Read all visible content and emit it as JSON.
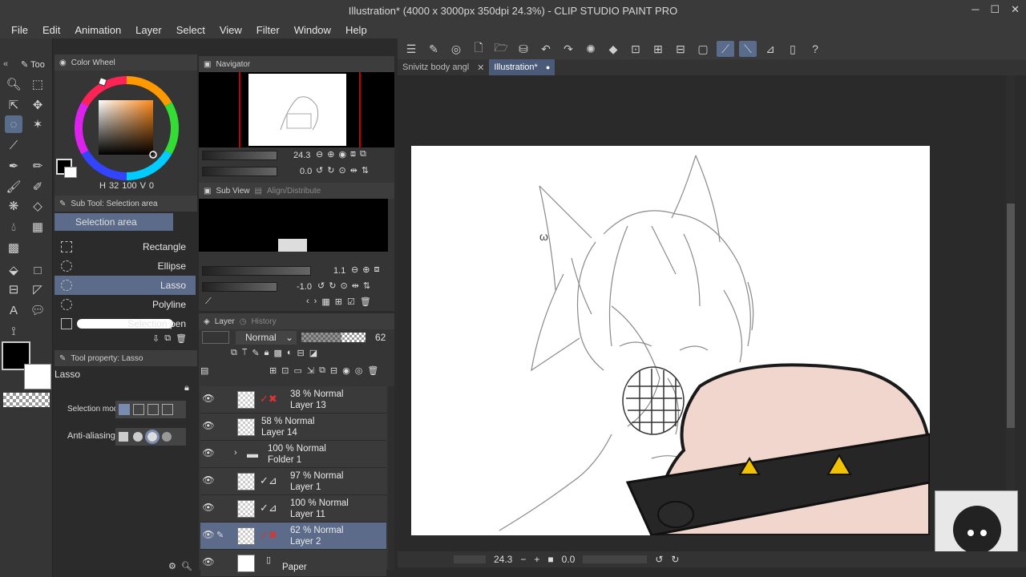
{
  "window": {
    "title": "Illustration* (4000 x 3000px 350dpi 24.3%) - CLIP STUDIO PAINT PRO",
    "controls": [
      "─",
      "☐",
      "✕"
    ]
  },
  "menu": [
    "File",
    "Edit",
    "Animation",
    "Layer",
    "Select",
    "View",
    "Filter",
    "Window",
    "Help"
  ],
  "doc_tabs": [
    {
      "label": "Snivitz body angl",
      "active": false
    },
    {
      "label": "Illustration*",
      "active": true
    }
  ],
  "tool_panel": {
    "tab_label": "Too"
  },
  "color_wheel": {
    "title": "Color Wheel",
    "value_a": "32",
    "value_b": "100",
    "value_c": "0",
    "main_color": "#000000",
    "sub_color": "#ffffff"
  },
  "navigator": {
    "title": "Navigator",
    "zoom": "24.3",
    "rotation": "0.0"
  },
  "sub_view": {
    "title": "Sub View",
    "tab2": "Align/Distribute",
    "zoom": "1.1",
    "rotation": "-1.0"
  },
  "sub_tool": {
    "title": "Sub Tool: Selection area",
    "group": "Selection area",
    "items": [
      {
        "label": "Rectangle",
        "selected": false
      },
      {
        "label": "Ellipse",
        "selected": false
      },
      {
        "label": "Lasso",
        "selected": true
      },
      {
        "label": "Polyline",
        "selected": false
      },
      {
        "label": "Selection pen",
        "selected": false
      }
    ]
  },
  "tool_property": {
    "title": "Tool property: Lasso",
    "tool_name": "Lasso",
    "selection_mode_label": "Selection mod",
    "anti_aliasing_label": "Anti-aliasing"
  },
  "layer_panel": {
    "title": "Layer",
    "tab2": "History",
    "blend_mode": "Normal",
    "opacity": "62",
    "opacity_fraction": 0.62,
    "layers": [
      {
        "line1": "38 % Normal",
        "line2": "Layer 13",
        "mark": "red-x",
        "selected": false
      },
      {
        "line1": "58 % Normal",
        "line2": "Layer 14",
        "mark": "none",
        "selected": false
      },
      {
        "line1": "100 % Normal",
        "line2": "Folder 1",
        "mark": "folder",
        "selected": false
      },
      {
        "line1": "97 % Normal",
        "line2": "Layer 1",
        "mark": "check",
        "selected": false
      },
      {
        "line1": "100 % Normal",
        "line2": "Layer 11",
        "mark": "check",
        "selected": false
      },
      {
        "line1": "62 % Normal",
        "line2": "Layer 2",
        "mark": "red-x",
        "selected": true
      },
      {
        "line1": "",
        "line2": "Paper",
        "mark": "paper",
        "selected": false
      }
    ]
  },
  "status": {
    "zoom": "24.3",
    "rotation": "0.0"
  },
  "colors": {
    "accent": "#5c6b8a",
    "panel": "#353535",
    "background": "#2b2b2b"
  }
}
